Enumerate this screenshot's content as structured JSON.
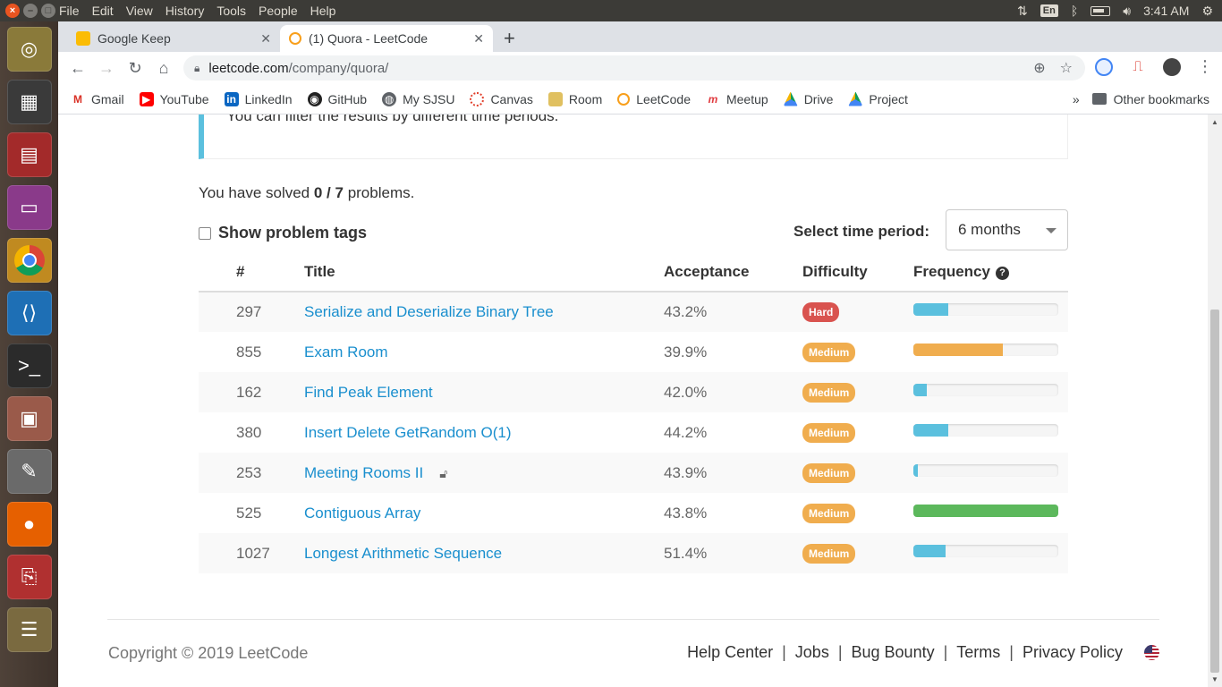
{
  "os": {
    "menu": [
      "File",
      "Edit",
      "View",
      "History",
      "Tools",
      "People",
      "Help"
    ],
    "keyboard": "En",
    "time": "3:41 AM"
  },
  "browser": {
    "tabs": [
      {
        "title": "Google Keep"
      },
      {
        "title": "(1) Quora - LeetCode"
      }
    ],
    "url_domain": "leetcode.com",
    "url_path": "/company/quora/",
    "bookmarks": [
      "Gmail",
      "YouTube",
      "LinkedIn",
      "GitHub",
      "My SJSU",
      "Canvas",
      "Room",
      "LeetCode",
      "Meetup",
      "Drive",
      "Project"
    ],
    "more_bookmarks": "»",
    "other_bookmarks": "Other bookmarks"
  },
  "page": {
    "info_text": "You can filter the results by different time periods.",
    "solved_prefix": "You have solved ",
    "solved_count": "0 / 7",
    "solved_suffix": " problems.",
    "show_tags_label": "Show problem tags",
    "period_label": "Select time period:",
    "period_value": "6 months",
    "columns": {
      "num": "#",
      "title": "Title",
      "acceptance": "Acceptance",
      "difficulty": "Difficulty",
      "frequency": "Frequency"
    },
    "problems": [
      {
        "num": "297",
        "title": "Serialize and Deserialize Binary Tree",
        "acceptance": "43.2%",
        "difficulty": "Hard",
        "frequency": 0.24,
        "freq_color": "#5bc0de",
        "locked": false
      },
      {
        "num": "855",
        "title": "Exam Room",
        "acceptance": "39.9%",
        "difficulty": "Medium",
        "frequency": 0.62,
        "freq_color": "#f0ad4e",
        "locked": false
      },
      {
        "num": "162",
        "title": "Find Peak Element",
        "acceptance": "42.0%",
        "difficulty": "Medium",
        "frequency": 0.09,
        "freq_color": "#5bc0de",
        "locked": false
      },
      {
        "num": "380",
        "title": "Insert Delete GetRandom O(1)",
        "acceptance": "44.2%",
        "difficulty": "Medium",
        "frequency": 0.24,
        "freq_color": "#5bc0de",
        "locked": false
      },
      {
        "num": "253",
        "title": "Meeting Rooms II",
        "acceptance": "43.9%",
        "difficulty": "Medium",
        "frequency": 0.03,
        "freq_color": "#5bc0de",
        "locked": true
      },
      {
        "num": "525",
        "title": "Contiguous Array",
        "acceptance": "43.8%",
        "difficulty": "Medium",
        "frequency": 1.0,
        "freq_color": "#5cb85c",
        "locked": false
      },
      {
        "num": "1027",
        "title": "Longest Arithmetic Sequence",
        "acceptance": "51.4%",
        "difficulty": "Medium",
        "frequency": 0.22,
        "freq_color": "#5bc0de",
        "locked": false
      }
    ]
  },
  "footer": {
    "copyright": "Copyright © 2019 LeetCode",
    "links": [
      "Help Center",
      "Jobs",
      "Bug Bounty",
      "Terms",
      "Privacy Policy"
    ],
    "separator": "|"
  }
}
